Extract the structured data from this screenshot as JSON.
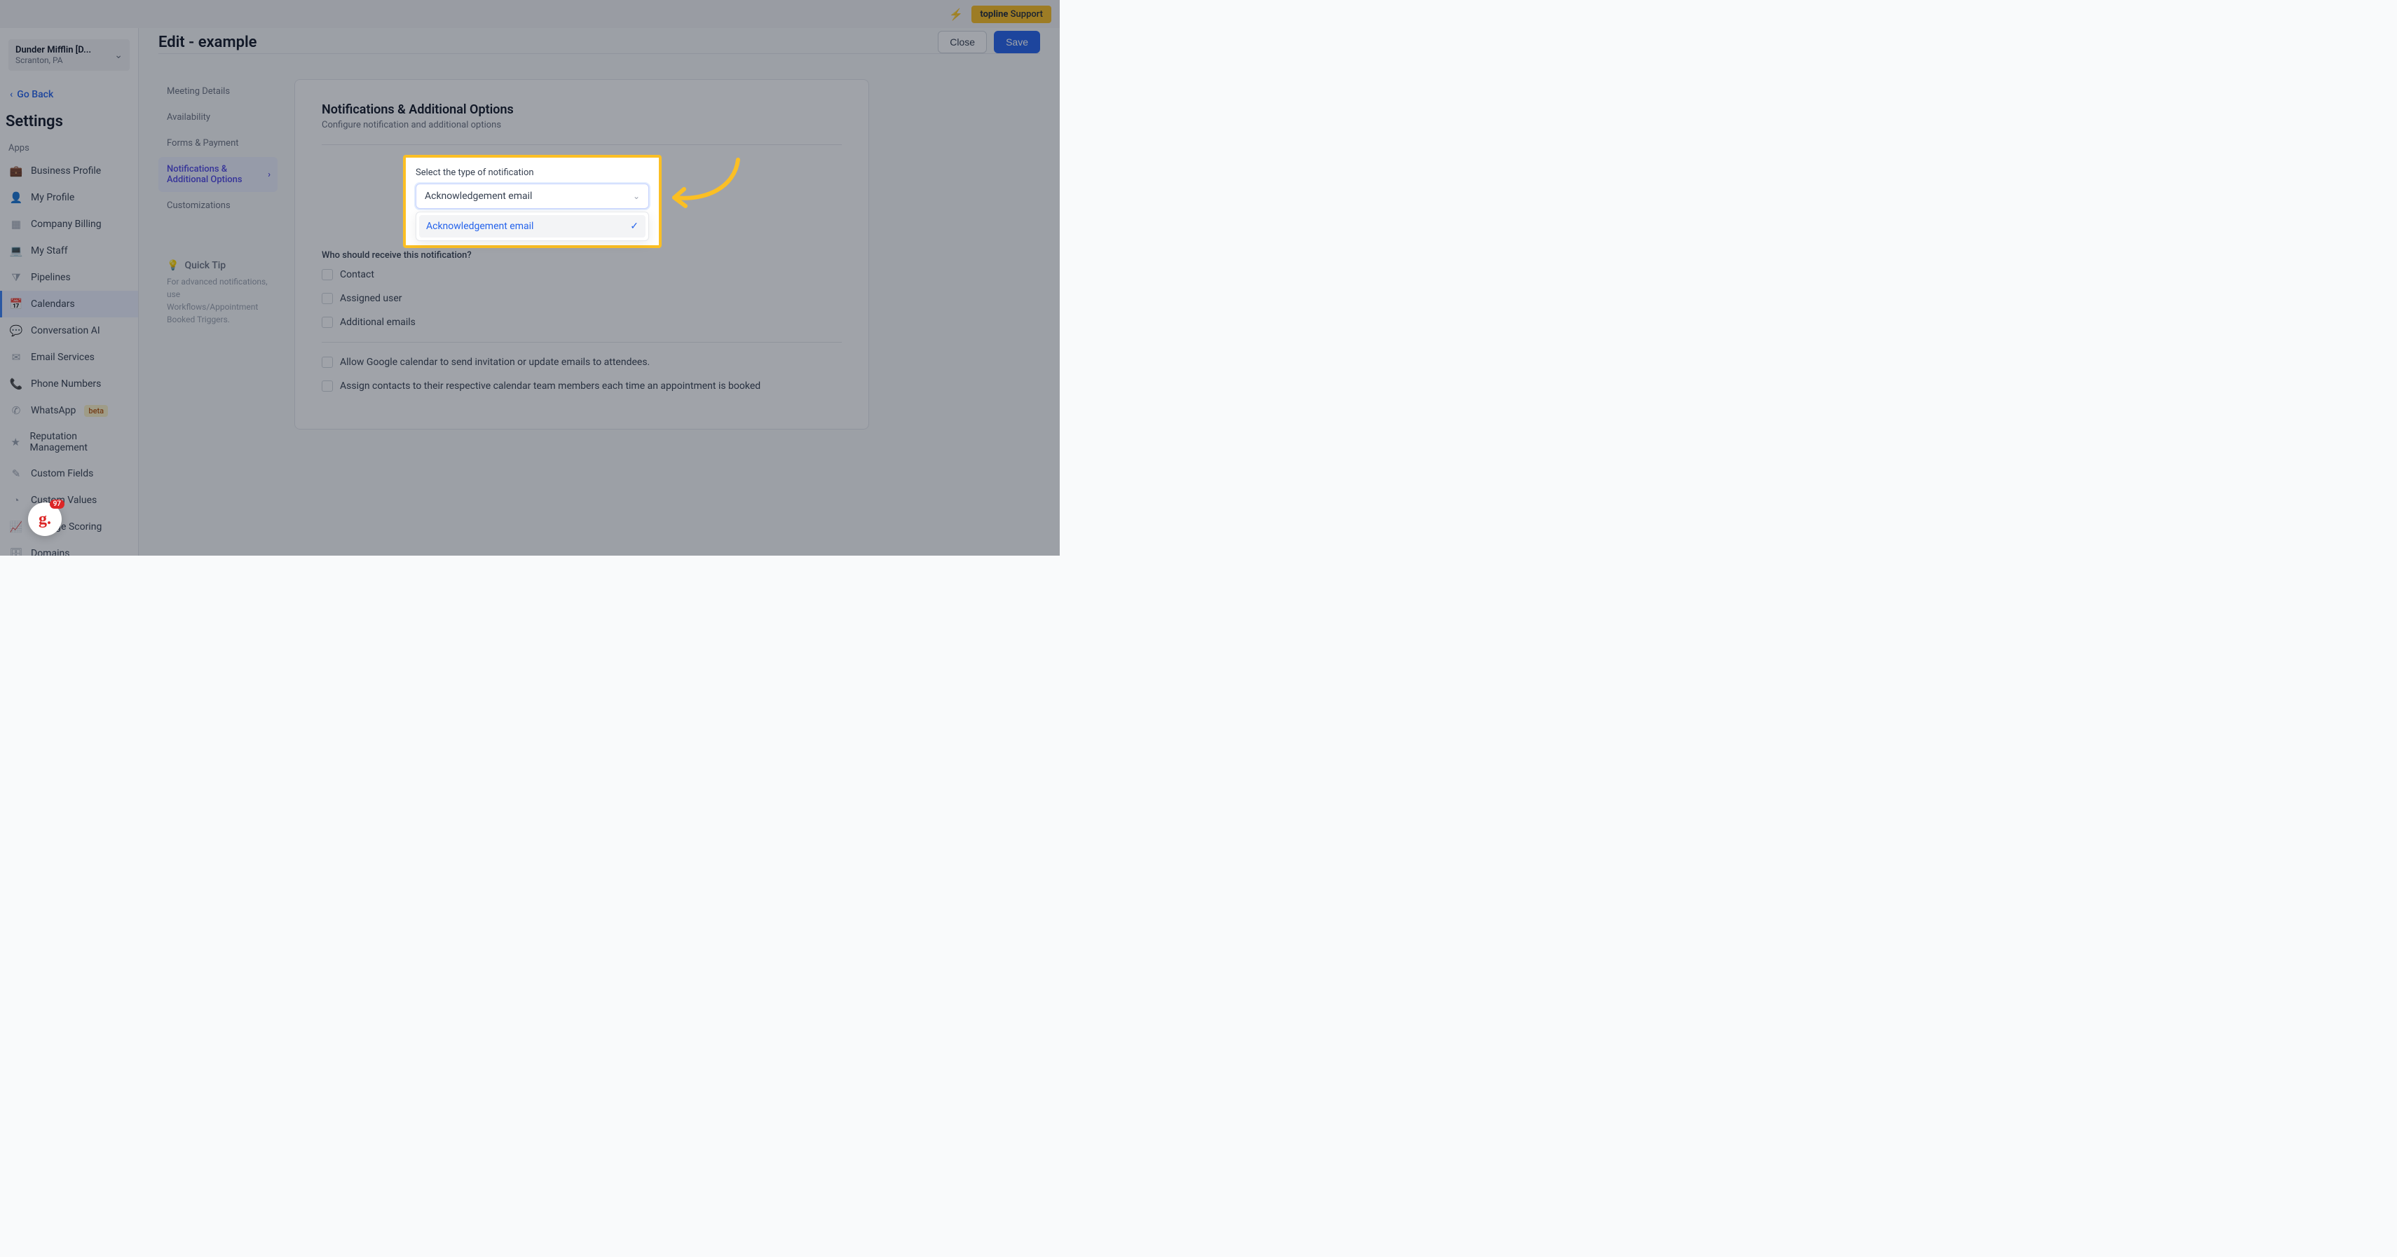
{
  "topbar": {
    "center_hint": "",
    "support": {
      "brand": "topline",
      "label": "Support"
    }
  },
  "sidebar": {
    "location": {
      "name": "Dunder Mifflin [D...",
      "sub": "Scranton, PA"
    },
    "go_back": "Go Back",
    "settings_title": "Settings",
    "section_label": "Apps",
    "items": [
      {
        "label": "Business Profile",
        "icon": "briefcase"
      },
      {
        "label": "My Profile",
        "icon": "user"
      },
      {
        "label": "Company Billing",
        "icon": "grid"
      },
      {
        "label": "My Staff",
        "icon": "laptop"
      },
      {
        "label": "Pipelines",
        "icon": "filter"
      },
      {
        "label": "Calendars",
        "icon": "calendar",
        "active": true
      },
      {
        "label": "Conversation AI",
        "icon": "chat"
      },
      {
        "label": "Email Services",
        "icon": "mail"
      },
      {
        "label": "Phone Numbers",
        "icon": "phone"
      },
      {
        "label": "WhatsApp",
        "icon": "whatsapp",
        "badge": "beta"
      },
      {
        "label": "Reputation Management",
        "icon": "star"
      },
      {
        "label": "Custom Fields",
        "icon": "edit"
      },
      {
        "label": "Custom Values",
        "icon": "pie"
      },
      {
        "label": "Manage Scoring",
        "icon": "chart"
      },
      {
        "label": "Domains",
        "icon": "db"
      }
    ]
  },
  "guide": {
    "letter": "g.",
    "count": "97"
  },
  "edit": {
    "title": "Edit - example",
    "close": "Close",
    "save": "Save"
  },
  "tabs": [
    "Meeting Details",
    "Availability",
    "Forms & Payment",
    "Notifications & Additional Options",
    "Customizations"
  ],
  "active_tab_index": 3,
  "tip": {
    "title": "Quick Tip",
    "body": "For advanced notifications, use Workflows/Appointment Booked Triggers."
  },
  "panel": {
    "title": "Notifications & Additional Options",
    "subtitle": "Configure notification and additional options",
    "select_label": "Select the type of notification",
    "select_value": "Acknowledgement email",
    "dropdown_option": "Acknowledgement email",
    "who_label": "Who should receive this notification?",
    "recipients": [
      "Contact",
      "Assigned user",
      "Additional emails"
    ],
    "opt_google": "Allow Google calendar to send invitation or update emails to attendees.",
    "opt_assign": "Assign contacts to their respective calendar team members each time an appointment is booked"
  }
}
